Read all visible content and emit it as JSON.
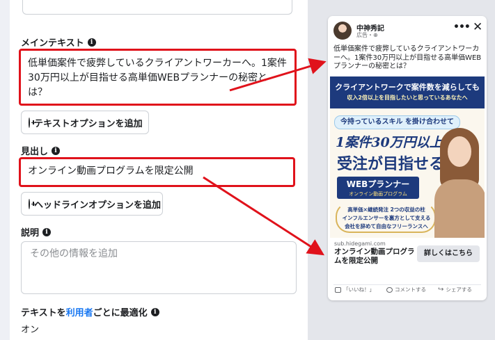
{
  "colors": {
    "annotation_red": "#e0121b",
    "link_blue": "#1877f2",
    "banner_navy": "#1d3a7d"
  },
  "editor": {
    "main_text": {
      "label": "メインテキスト",
      "value": "低単価案件で疲弊しているクライアントワーカーへ。1案件30万円以上が目指せる高単価WEBプランナーの秘密とは？",
      "add_option": "テキストオプションを追加"
    },
    "headline": {
      "label": "見出し",
      "value": "オンライン動画プログラムを限定公開",
      "add_option": "ヘッドラインオプションを追加"
    },
    "description": {
      "label": "説明",
      "placeholder": "その他の情報を追加"
    },
    "optimize": {
      "label_prefix": "テキストを",
      "label_link": "利用者",
      "label_suffix": "ごとに最適化",
      "value": "オン"
    }
  },
  "preview": {
    "page_name": "中神秀記",
    "sponsored": "広告・⊕",
    "primary_text": "低単価案件で疲弊しているクライアントワーカーへ。1案件30万円以上が目指せる高単価WEBプランナーの秘密とは？",
    "creative": {
      "top_line1": "クライアントワークで案件数を減らしても",
      "top_line2": "収入2倍以上を目指したいと思っているあなたへ",
      "skill_pill": "今持っているスキル を掛け合わせて",
      "big_line1": "1案件30万円以上の",
      "big_line2": "受注が目指せる！",
      "badge_title": "WEBプランナー",
      "badge_sub": "オンライン動画プログラム",
      "laurel_line1": "高単価×継続発注 2つの収益の柱",
      "laurel_line2": "インフルエンサーを裏方として支える",
      "laurel_line3": "会社を辞めて自由なフリーランスへ"
    },
    "link_domain": "sub.hidegami.com",
    "link_headline": "オンライン動画プログラムを限定公開",
    "cta": "詳しくはこちら",
    "actions": {
      "like": "「いいね！」",
      "comment": "コメントする",
      "share": "シェアする"
    }
  }
}
